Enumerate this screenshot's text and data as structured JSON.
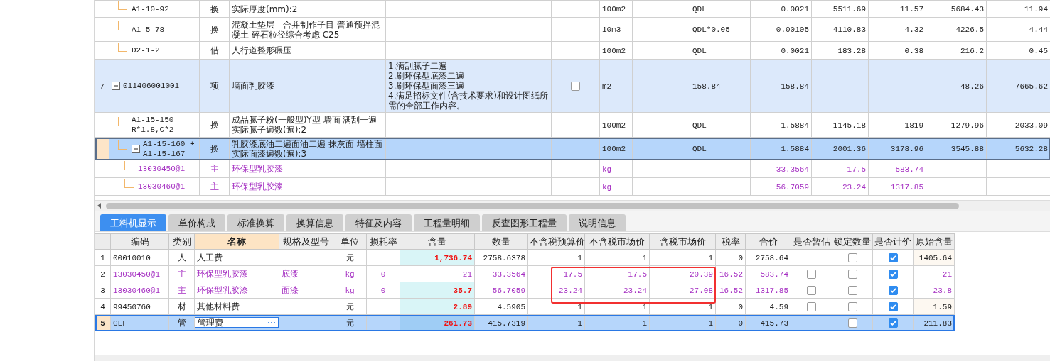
{
  "upper_grid": {
    "rows": [
      {
        "kind": "quota",
        "code": "A1-10-92",
        "type": "换",
        "name": "实际厚度(mm):2",
        "unit": "100m2",
        "expression": "QDL",
        "amounts": {
          "amount_1": "0.0021",
          "amount_2": "5511.69",
          "amount_3": "11.57",
          "amount_4": "5684.43",
          "amount_5": "11.94"
        },
        "selected": false
      },
      {
        "kind": "quota",
        "code": "A1-5-78",
        "type": "换",
        "name": "混凝土垫层　合并制作子目 普通预拌混凝土 碎石粒径综合考虑 C25",
        "unit": "10m3",
        "expression": "QDL*0.05",
        "amounts": {
          "amount_1": "0.00105",
          "amount_2": "4110.83",
          "amount_3": "4.32",
          "amount_4": "4226.5",
          "amount_5": "4.44"
        },
        "selected": false
      },
      {
        "kind": "quota",
        "code": "D2-1-2",
        "type": "借",
        "name": "人行道整形碾压",
        "unit": "100m2",
        "expression": "QDL",
        "amounts": {
          "amount_1": "0.0021",
          "amount_2": "183.28",
          "amount_3": "0.38",
          "amount_4": "216.2",
          "amount_5": "0.45"
        },
        "selected": false
      },
      {
        "kind": "item",
        "num": "7",
        "code": "011406001001",
        "type": "项",
        "name": "墙面乳胶漆",
        "feature": "1.满刮腻子二遍\n2.刷环保型底漆二遍\n3.刷环保型面漆三遍\n4.满足招标文件(含技术要求)和设计图纸所需的全部工作内容。",
        "checked": false,
        "unit": "m2",
        "expression": "158.84",
        "amounts": {
          "amount_1": "158.84",
          "amount_4": "48.26",
          "amount_5": "7665.62"
        },
        "selected": false,
        "expanded": true,
        "children": [
          {
            "kind": "quota",
            "code": "A1-15-150\nR*1.8,C*2",
            "type": "换",
            "name": "成品腻子粉(一般型)Y型 墙面 满刮一遍实际腻子遍数(遍):2",
            "unit": "100m2",
            "expression": "QDL",
            "amounts": {
              "amount_1": "1.5884",
              "amount_2": "1145.18",
              "amount_3": "1819",
              "amount_4": "1279.96",
              "amount_5": "2033.09"
            },
            "selected": false
          },
          {
            "kind": "quota",
            "code": "A1-15-160 +\nA1-15-167",
            "type": "换",
            "name": "乳胶漆底油二遍面油二遍 抹灰面 墙柱面实际面漆遍数(遍):3",
            "unit": "100m2",
            "expression": "QDL",
            "amounts": {
              "amount_1": "1.5884",
              "amount_2": "2001.36",
              "amount_3": "3178.96",
              "amount_4": "3545.88",
              "amount_5": "5632.28"
            },
            "selected": true,
            "expanded": true,
            "children": [
              {
                "kind": "material",
                "code": "13030450@1",
                "type": "主",
                "name": "环保型乳胶漆",
                "unit": "kg",
                "amounts": {
                  "amount_1": "33.3564",
                  "amount_2": "17.5",
                  "amount_3": "583.74"
                },
                "selected": false
              },
              {
                "kind": "material",
                "code": "13030460@1",
                "type": "主",
                "name": "环保型乳胶漆",
                "unit": "kg",
                "amounts": {
                  "amount_1": "56.7059",
                  "amount_2": "23.24",
                  "amount_3": "1317.85"
                },
                "selected": false
              }
            ]
          }
        ]
      }
    ]
  },
  "tabs": [
    {
      "label": "工料机显示",
      "selected": true
    },
    {
      "label": "单价构成",
      "selected": false
    },
    {
      "label": "标准换算",
      "selected": false
    },
    {
      "label": "换算信息",
      "selected": false
    },
    {
      "label": "特征及内容",
      "selected": false
    },
    {
      "label": "工程量明细",
      "selected": false
    },
    {
      "label": "反查图形工程量",
      "selected": false
    },
    {
      "label": "说明信息",
      "selected": false
    }
  ],
  "resource_table": {
    "columns": [
      {
        "label": "编码",
        "selected": false
      },
      {
        "label": "类别",
        "selected": false
      },
      {
        "label": "名称",
        "selected": true
      },
      {
        "label": "规格及型号",
        "selected": false
      },
      {
        "label": "单位",
        "selected": false
      },
      {
        "label": "损耗率",
        "selected": false
      },
      {
        "label": "含量",
        "selected": false
      },
      {
        "label": "数量",
        "selected": false
      },
      {
        "label": "不含税预算价",
        "selected": false
      },
      {
        "label": "不含税市场价",
        "selected": false
      },
      {
        "label": "含税市场价",
        "selected": false
      },
      {
        "label": "税率",
        "selected": false
      },
      {
        "label": "合价",
        "selected": false
      },
      {
        "label": "是否暂估",
        "selected": false
      },
      {
        "label": "锁定数量",
        "selected": false
      },
      {
        "label": "是否计价",
        "selected": false
      },
      {
        "label": "原始含量",
        "selected": false
      }
    ],
    "rows": [
      {
        "num": "1",
        "kind": "normal",
        "code": "00010010",
        "type": "人",
        "name": "人工费",
        "unit": "元",
        "content": "1,736.74",
        "content_changed": true,
        "quantity": "2758.6378",
        "budget_price": "1",
        "market_price": "1",
        "market_price_tax": "1",
        "tax_rate": "0",
        "total": "2758.64",
        "locked": false,
        "priced": true,
        "original": "1405.64",
        "selected": false
      },
      {
        "num": "2",
        "kind": "main_material",
        "code": "13030450@1",
        "type": "主",
        "name": "环保型乳胶漆",
        "spec": "底漆",
        "unit": "kg",
        "loss": "0",
        "content": "21",
        "content_changed": false,
        "quantity": "33.3564",
        "budget_price": "17.5",
        "market_price": "17.5",
        "market_price_tax": "20.39",
        "tax_rate": "16.52",
        "total": "583.74",
        "estimated": false,
        "locked": false,
        "priced": true,
        "original": "21",
        "selected": false
      },
      {
        "num": "3",
        "kind": "main_material",
        "code": "13030460@1",
        "type": "主",
        "name": "环保型乳胶漆",
        "spec": "面漆",
        "unit": "kg",
        "loss": "0",
        "content": "35.7",
        "content_changed": true,
        "quantity": "56.7059",
        "budget_price": "23.24",
        "market_price": "23.24",
        "market_price_tax": "27.08",
        "tax_rate": "16.52",
        "total": "1317.85",
        "estimated": false,
        "locked": false,
        "priced": true,
        "original": "23.8",
        "selected": false
      },
      {
        "num": "4",
        "kind": "normal",
        "code": "99450760",
        "type": "材",
        "name": "其他材料费",
        "unit": "元",
        "content": "2.89",
        "content_changed": true,
        "quantity": "4.5905",
        "budget_price": "1",
        "market_price": "1",
        "market_price_tax": "1",
        "tax_rate": "0",
        "total": "4.59",
        "estimated": false,
        "locked": false,
        "priced": true,
        "original": "1.59",
        "selected": false
      },
      {
        "num": "5",
        "kind": "normal",
        "code": "GLF",
        "type": "管",
        "name": "管理费",
        "unit": "元",
        "content": "261.73",
        "content_changed": true,
        "quantity": "415.7319",
        "budget_price": "1",
        "market_price": "1",
        "market_price_tax": "1",
        "tax_rate": "0",
        "total": "415.73",
        "locked": false,
        "priced": true,
        "original": "211.83",
        "selected": true
      }
    ]
  }
}
